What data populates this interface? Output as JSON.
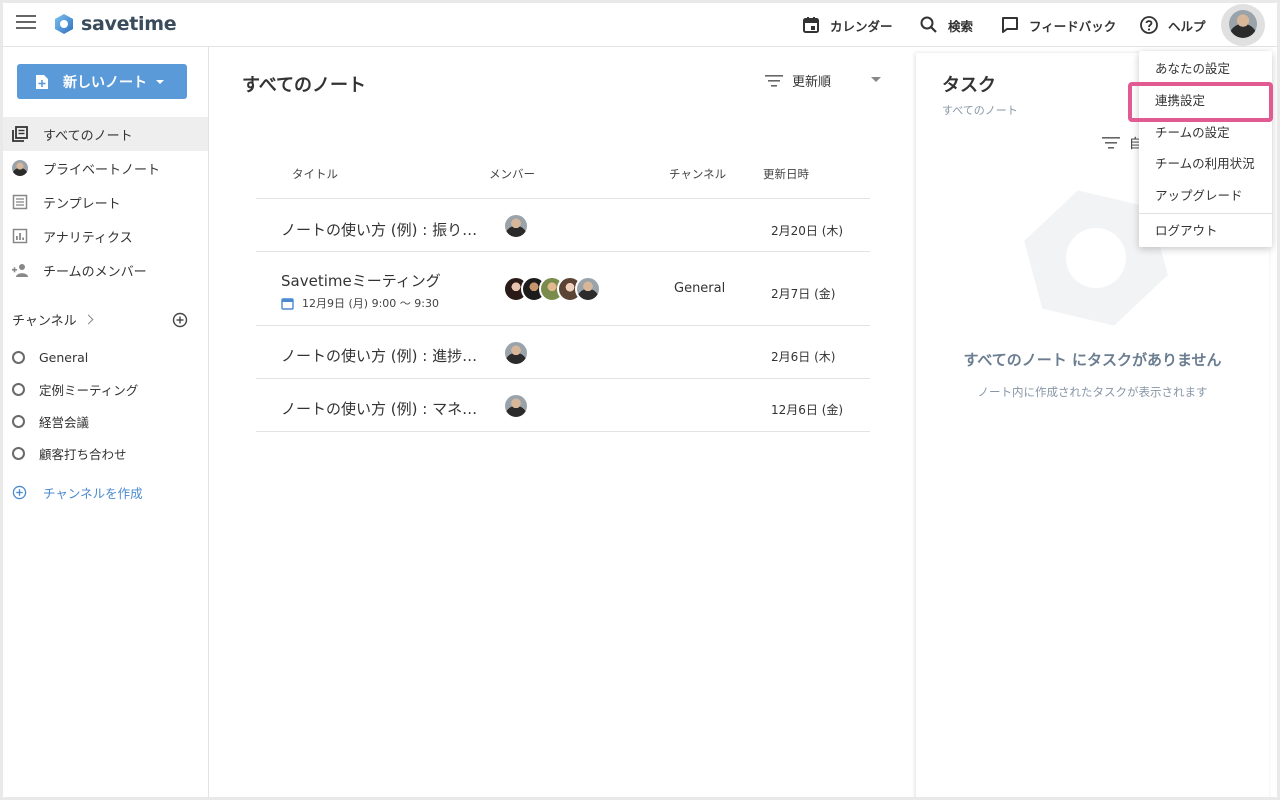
{
  "app": {
    "name": "savetime",
    "brand_color": "#5b9ad9",
    "accent_color": "#e15a92"
  },
  "header": {
    "calendar_label": "カレンダー",
    "search_label": "検索",
    "feedback_label": "フィードバック",
    "help_label": "ヘルプ",
    "icons": [
      "menu-icon",
      "calendar-icon",
      "search-icon",
      "feedback-icon",
      "help-icon",
      "avatar"
    ]
  },
  "sidebar": {
    "new_note_label": "新しいノート",
    "items": [
      {
        "label": "すべてのノート",
        "icon": "notes-icon",
        "active": true
      },
      {
        "label": "プライベートノート",
        "icon": "avatar"
      },
      {
        "label": "テンプレート",
        "icon": "template-icon"
      },
      {
        "label": "アナリティクス",
        "icon": "analytics-icon"
      },
      {
        "label": "チームのメンバー",
        "icon": "add-person-icon"
      }
    ],
    "channels_title": "チャンネル",
    "channels": [
      {
        "label": "General"
      },
      {
        "label": "定例ミーティング"
      },
      {
        "label": "経営会議"
      },
      {
        "label": "顧客打ち合わせ"
      }
    ],
    "create_channel_label": "チャンネルを作成"
  },
  "main": {
    "title": "すべてのノート",
    "sort_label": "更新順",
    "columns": {
      "title": "タイトル",
      "members": "メンバー",
      "channel": "チャンネル",
      "updated": "更新日時"
    },
    "rows": [
      {
        "title": "ノートの使い方 (例) : 振り…",
        "members": 1,
        "channel": "",
        "date": "2月20日 (木)"
      },
      {
        "title": "Savetimeミーティング",
        "subtitle": "12月9日 (月) 9:00 〜 9:30",
        "members": 5,
        "channel": "General",
        "date": "2月7日 (金)"
      },
      {
        "title": "ノートの使い方 (例) : 進捗…",
        "members": 1,
        "channel": "",
        "date": "2月6日 (木)"
      },
      {
        "title": "ノートの使い方 (例) : マネ…",
        "members": 1,
        "channel": "",
        "date": "12月6日 (金)"
      }
    ]
  },
  "tasks": {
    "title": "タスク",
    "subtitle": "すべてのノート",
    "filter_label": "自",
    "empty_title": "すべてのノート にタスクがありません",
    "empty_sub": "ノート内に作成されたタスクが表示されます"
  },
  "user_menu": {
    "items": [
      {
        "label": "あなたの設定"
      },
      {
        "label": "連携設定",
        "highlighted": true
      },
      {
        "label": "チームの設定"
      },
      {
        "label": "チームの利用状況"
      },
      {
        "label": "アップグレード"
      },
      {
        "label": "ログアウト"
      }
    ]
  }
}
